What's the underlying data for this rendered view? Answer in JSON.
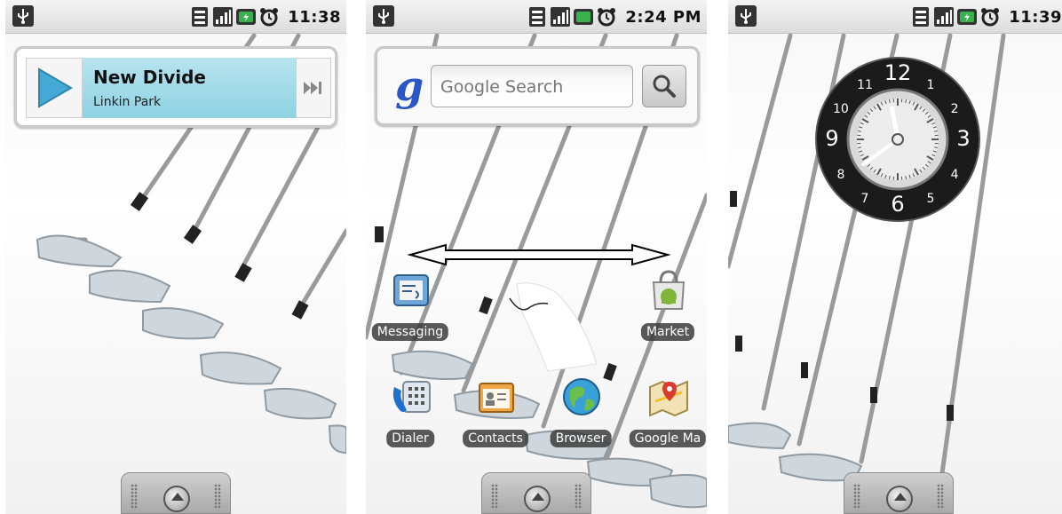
{
  "screens": [
    {
      "status_bar": {
        "time": "11:38"
      },
      "music_widget": {
        "title": "New Divide",
        "artist": "Linkin Park"
      }
    },
    {
      "status_bar": {
        "time": "2:24 PM"
      },
      "search_widget": {
        "placeholder": "Google Search",
        "logo": "g"
      },
      "apps": [
        {
          "label": "Messaging",
          "icon": "messaging-icon"
        },
        {
          "label": "Market",
          "icon": "market-icon"
        },
        {
          "label": "Dialer",
          "icon": "dialer-icon"
        },
        {
          "label": "Contacts",
          "icon": "contacts-icon"
        },
        {
          "label": "Browser",
          "icon": "browser-icon"
        },
        {
          "label": "Google Ma",
          "icon": "maps-icon"
        }
      ]
    },
    {
      "status_bar": {
        "time": "11:39"
      },
      "clock_widget": {
        "numerals": [
          "12",
          "1",
          "2",
          "3",
          "4",
          "5",
          "6",
          "7",
          "8",
          "9",
          "10",
          "11"
        ],
        "hour": 11,
        "minute": 39
      }
    }
  ],
  "colors": {
    "accent": "#8fd2e3",
    "battery_green": "#37b24d",
    "label_bg": "#3c3c3c"
  }
}
